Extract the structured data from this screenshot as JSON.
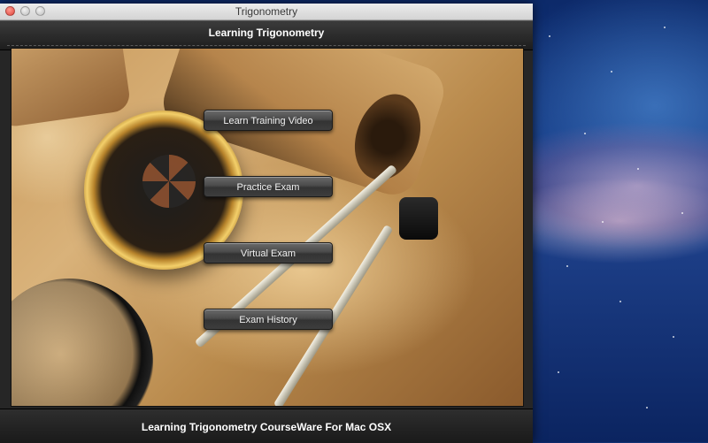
{
  "window": {
    "title": "Trigonometry"
  },
  "header": {
    "title": "Learning Trigonometry"
  },
  "menu": {
    "buttons": [
      {
        "label": "Learn Training Video"
      },
      {
        "label": "Practice Exam"
      },
      {
        "label": "Virtual Exam"
      },
      {
        "label": "Exam History"
      }
    ]
  },
  "footer": {
    "title": "Learning Trigonometry CourseWare For Mac OSX"
  },
  "colors": {
    "header_bg": "#262626",
    "button_bg": "#4a4a4a",
    "text": "#ffffff"
  }
}
